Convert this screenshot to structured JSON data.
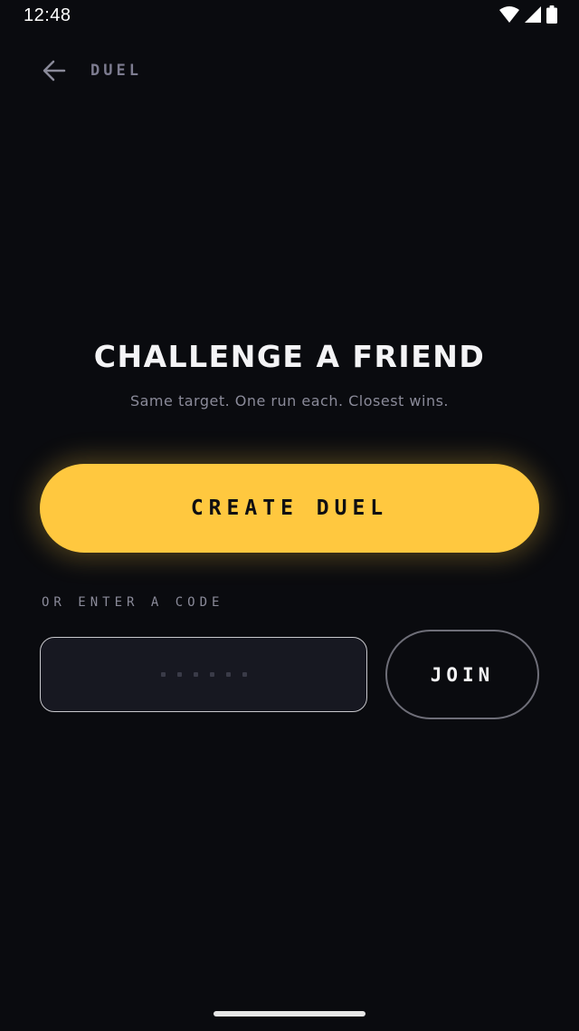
{
  "status_bar": {
    "time": "12:48",
    "icons": [
      "wifi-icon",
      "cellular-signal-icon",
      "battery-icon"
    ]
  },
  "header": {
    "back_icon": "arrow-left-icon",
    "title": "DUEL"
  },
  "hero": {
    "headline": "CHALLENGE A FRIEND",
    "subline": "Same target. One run each. Closest wins."
  },
  "create_button": {
    "label": "CREATE DUEL"
  },
  "join_section": {
    "label": "OR ENTER A CODE",
    "input_placeholder": "······",
    "code_length": 6,
    "join_label": "JOIN"
  },
  "colors": {
    "background": "#0a0b0f",
    "accent": "#ffc83f",
    "muted_text": "#8a8a99",
    "input_background": "#171821"
  }
}
